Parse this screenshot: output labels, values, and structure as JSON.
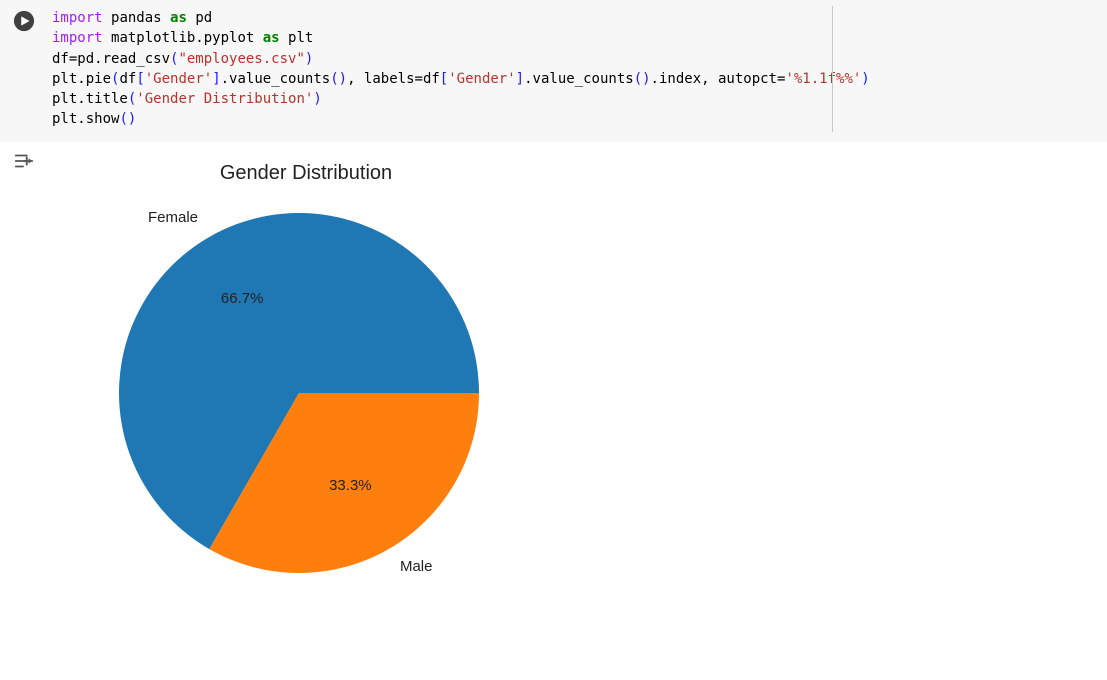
{
  "code": {
    "tokens": [
      [
        [
          "kw2",
          "import"
        ],
        [
          "sp",
          " "
        ],
        [
          "name",
          "pandas"
        ],
        [
          "sp",
          " "
        ],
        [
          "kw",
          "as"
        ],
        [
          "sp",
          " "
        ],
        [
          "name",
          "pd"
        ]
      ],
      [
        [
          "kw2",
          "import"
        ],
        [
          "sp",
          " "
        ],
        [
          "name",
          "matplotlib.pyplot"
        ],
        [
          "sp",
          " "
        ],
        [
          "kw",
          "as"
        ],
        [
          "sp",
          " "
        ],
        [
          "name",
          "plt"
        ]
      ],
      [
        [
          "name",
          "df"
        ],
        [
          "op",
          "="
        ],
        [
          "name",
          "pd.read_csv"
        ],
        [
          "paren",
          "("
        ],
        [
          "str",
          "\"employees.csv\""
        ],
        [
          "paren",
          ")"
        ]
      ],
      [
        [
          "name",
          "plt.pie"
        ],
        [
          "paren",
          "("
        ],
        [
          "name",
          "df"
        ],
        [
          "paren",
          "["
        ],
        [
          "str",
          "'Gender'"
        ],
        [
          "paren",
          "]"
        ],
        [
          "name",
          ".value_counts"
        ],
        [
          "paren",
          "()"
        ],
        [
          "op",
          ", "
        ],
        [
          "name",
          "labels"
        ],
        [
          "op",
          "="
        ],
        [
          "name",
          "df"
        ],
        [
          "paren",
          "["
        ],
        [
          "str",
          "'Gender'"
        ],
        [
          "paren",
          "]"
        ],
        [
          "name",
          ".value_counts"
        ],
        [
          "paren",
          "()"
        ],
        [
          "name",
          ".index"
        ],
        [
          "op",
          ", "
        ],
        [
          "name",
          "autopct"
        ],
        [
          "op",
          "="
        ],
        [
          "str",
          "'%1.1f%%'"
        ],
        [
          "paren",
          ")"
        ]
      ],
      [
        [
          "name",
          "plt.title"
        ],
        [
          "paren",
          "("
        ],
        [
          "str",
          "'Gender Distribution'"
        ],
        [
          "paren",
          ")"
        ]
      ],
      [
        [
          "name",
          "plt.show"
        ],
        [
          "paren",
          "()"
        ]
      ]
    ]
  },
  "chart_data": {
    "type": "pie",
    "title": "Gender Distribution",
    "categories": [
      "Female",
      "Male"
    ],
    "values": [
      66.7,
      33.3
    ],
    "pct_labels": [
      "66.7%",
      "33.3%"
    ],
    "colors": [
      "#1f77b4",
      "#ff7f0e"
    ]
  }
}
